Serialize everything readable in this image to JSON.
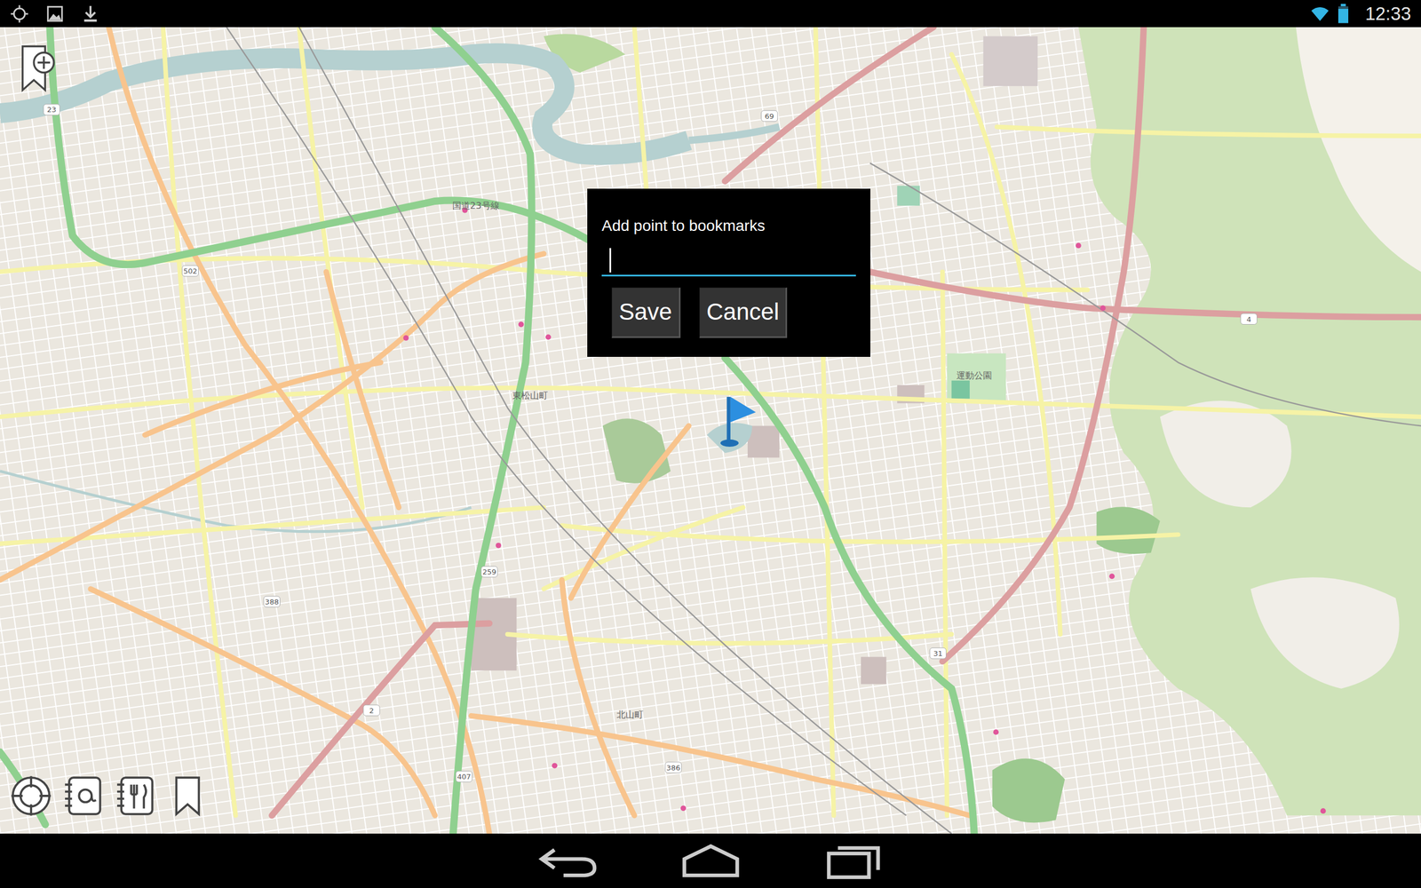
{
  "status_bar": {
    "time": "12:33",
    "battery": {
      "level": 0.85
    }
  },
  "dialog": {
    "title": "Add point to bookmarks",
    "field": {
      "value": "",
      "focused": true
    },
    "buttons": [
      "Save",
      "Cancel"
    ]
  },
  "map": {
    "shields": [
      "23",
      "502",
      "259",
      "69",
      "4",
      "31",
      "386",
      "407",
      "2",
      "388"
    ],
    "places": [
      "東松山町",
      "北山町",
      "国道23号線",
      "運動公園"
    ]
  }
}
